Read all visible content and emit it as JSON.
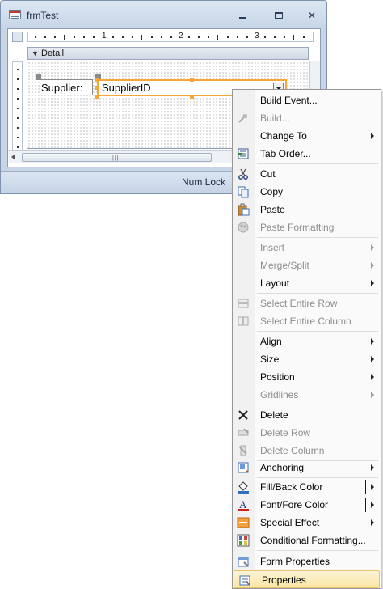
{
  "window": {
    "title": "frmTest",
    "status": "Num Lock"
  },
  "form": {
    "section_label": "Detail",
    "ruler_numbers": [
      "1",
      "2",
      "3"
    ],
    "label_text": "Supplier:",
    "combo_text": "SupplierID"
  },
  "menu": {
    "build_event": "Build Event...",
    "build": "Build...",
    "change_to": "Change To",
    "tab_order": "Tab Order...",
    "cut": "Cut",
    "copy": "Copy",
    "paste": "Paste",
    "paste_formatting": "Paste Formatting",
    "insert": "Insert",
    "merge_split": "Merge/Split",
    "layout": "Layout",
    "select_entire_row": "Select Entire Row",
    "select_entire_column": "Select Entire Column",
    "align": "Align",
    "size": "Size",
    "position": "Position",
    "gridlines": "Gridlines",
    "delete": "Delete",
    "delete_row": "Delete Row",
    "delete_column": "Delete Column",
    "anchoring": "Anchoring",
    "fill_back_color": "Fill/Back Color",
    "font_fore_color": "Font/Fore Color",
    "special_effect": "Special Effect",
    "conditional_formatting": "Conditional Formatting...",
    "form_properties": "Form Properties",
    "properties": "Properties"
  },
  "colors": {
    "selection_orange": "#f7a637",
    "menu_highlight": "#fbe6a4",
    "disabled_text": "#8d8d8d"
  }
}
